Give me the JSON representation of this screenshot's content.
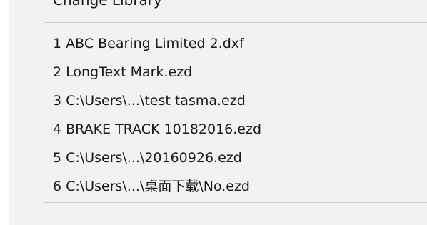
{
  "menu": {
    "clipped_item_label": "Change Library",
    "recent_files": [
      {
        "label": "1 ABC Bearing Limited 2.dxf"
      },
      {
        "label": "2 LongText Mark.ezd"
      },
      {
        "label": "3 C:\\Users\\...\\test tasma.ezd"
      },
      {
        "label": "4 BRAKE TRACK 10182016.ezd"
      },
      {
        "label": "5 C:\\Users\\...\\20160926.ezd"
      },
      {
        "label": "6 C:\\Users\\...\\桌面下载\\No.ezd"
      }
    ]
  }
}
